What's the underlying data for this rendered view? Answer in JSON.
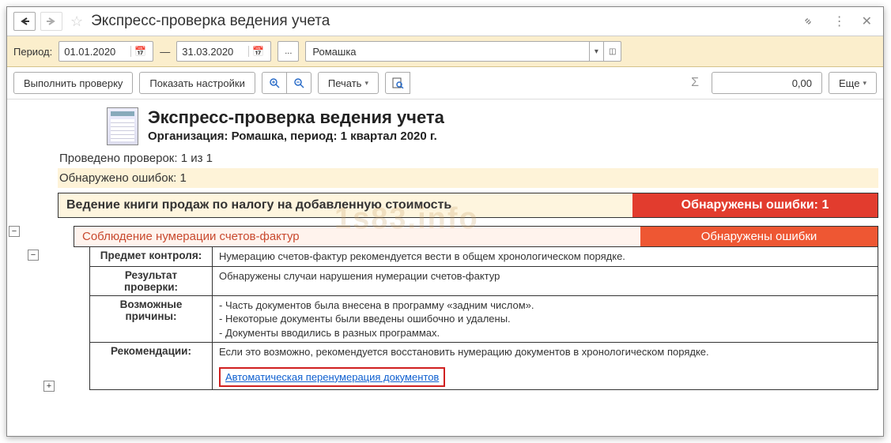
{
  "title": "Экспресс-проверка ведения учета",
  "period": {
    "label": "Период:",
    "from": "01.01.2020",
    "to": "31.03.2020",
    "more": "...",
    "org": "Ромашка"
  },
  "toolbar": {
    "run": "Выполнить проверку",
    "settings": "Показать настройки",
    "print": "Печать",
    "sum": "0,00",
    "more_btn": "Еще"
  },
  "report": {
    "title": "Экспресс-проверка ведения учета",
    "subtitle": "Организация: Ромашка, период: 1 квартал 2020 г.",
    "checks_line": "Проведено проверок: 1 из 1",
    "errors_line": "Обнаружено ошибок: 1",
    "section1": {
      "title": "Ведение книги продаж по налогу на добавленную стоимость",
      "status": "Обнаружены ошибки: 1"
    },
    "section2": {
      "title": "Соблюдение нумерации счетов-фактур",
      "status": "Обнаружены ошибки"
    },
    "rows": [
      {
        "label": "Предмет контроля:",
        "value": "Нумерацию счетов-фактур рекомендуется вести в общем хронологическом порядке."
      },
      {
        "label": "Результат проверки:",
        "value": "Обнаружены случаи нарушения нумерации счетов-фактур"
      },
      {
        "label": "Возможные причины:",
        "value": "- Часть документов была внесена в программу «задним числом».\n- Некоторые документы были введены ошибочно и удалены.\n- Документы вводились в разных программах."
      },
      {
        "label": "Рекомендации:",
        "value": "Если это возможно, рекомендуется восстановить нумерацию документов в хронологическом порядке."
      }
    ],
    "link": "Автоматическая перенумерация документов"
  },
  "watermark": "1s83.info"
}
